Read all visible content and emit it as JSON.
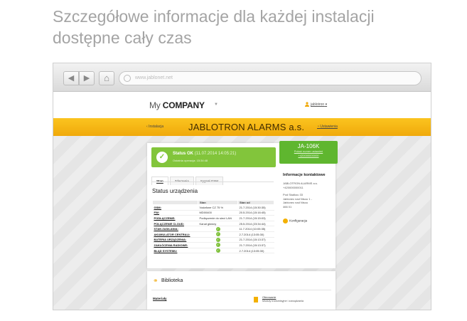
{
  "headline": {
    "line1": "Szczegółowe informacje dla każdej instalacji",
    "line2": "dostępne cały czas"
  },
  "browser": {
    "url": "www.jablonet.net",
    "back_icon": "back-arrow-icon",
    "forward_icon": "forward-arrow-icon",
    "home_icon": "home-icon"
  },
  "site": {
    "logo_my": "My",
    "logo_company": "COMPANY",
    "user_name": "jablotron",
    "breadcrumb": "‹ Instalacja",
    "brand": "JABLOTRON ALARMS a.s.",
    "signout": "Ustawienia",
    "status": {
      "title": "Status OK",
      "time": "(11.07.2014 14:05:21)",
      "subtitle": "Ostatnia operacja: 15:34:48",
      "color": "#82c53b"
    },
    "device": {
      "model": "JA-106K",
      "line1": "Pokaż numer ustawień",
      "line2": "+420000000000"
    },
    "tabs": [
      "Stan",
      "Zdarzenia",
      "Sygnał GSM"
    ],
    "section_title": "Status urządzenia",
    "table": {
      "headers": [
        "",
        "Stan",
        "Stan od"
      ],
      "rows": [
        {
          "label": "GSM:",
          "value": "Vodafone CZ 75 %",
          "since": "21.7.2014 (15:30:35)",
          "ok": false
        },
        {
          "label": "FW:",
          "value": "MD00400",
          "since": "20.5.2014 (15:16:45)",
          "ok": false
        },
        {
          "label": "PODŁĄCZENIE:",
          "value": "Podłączenie do sieci LAN",
          "since": "21.7.2014 (15:15:03)",
          "ok": false
        },
        {
          "label": "POŁĄCZENIE CLOUD:",
          "value": "Kanał główny",
          "since": "25.5.2014 (23:34:44)",
          "ok": false
        },
        {
          "label": "STAN ZASILANIA:",
          "value": "",
          "since": "11.7.2014 (10:05:35)",
          "ok": true
        },
        {
          "label": "AKUMULATOR CENTRALI:",
          "value": "",
          "since": "2.7.2014 (13:05:30)",
          "ok": true
        },
        {
          "label": "BATERIA URZĄDZENIA:",
          "value": "",
          "since": "21.7.2014 (15:13:37)",
          "ok": true
        },
        {
          "label": "ZAKŁÓCENIA RADIOWE:",
          "value": "",
          "since": "21.7.2014 (15:13:37)",
          "ok": true
        },
        {
          "label": "BŁĄD SYSTEMU:",
          "value": "",
          "since": "2.7.2014 (13:05:30)",
          "ok": true
        }
      ]
    },
    "contact": {
      "heading": "Informacje kontaktowe",
      "company": "JABLOTRON ALARMS a.s.",
      "phone": "+420000000011",
      "addr1": "Pod Skalkou 33",
      "addr2": "Jablonec nad Nisou 1 -",
      "addr3": "Jablonec nad Nisou",
      "zip": "466 01",
      "config": "Konfiguracja"
    },
    "library": {
      "title": "Biblioteka",
      "left": "Materiały",
      "right_title": "Oferowanie",
      "right_sub": "Moduły transmisyjne i zarządzania"
    }
  }
}
